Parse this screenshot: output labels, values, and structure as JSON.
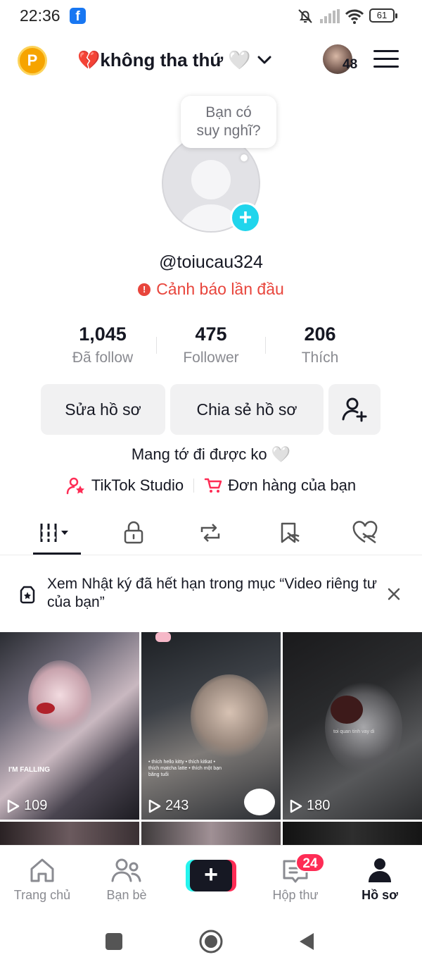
{
  "status_bar": {
    "time": "22:36",
    "app_badge": "f",
    "battery": "61"
  },
  "header": {
    "points_badge": "P",
    "title": "💔không tha thứ 🤍",
    "notification_count": "48"
  },
  "profile": {
    "tooltip_line1": "Bạn có",
    "tooltip_line2": "suy nghĩ?",
    "username": "@toiucau324",
    "warning": "Cảnh báo lần đầu",
    "stats": [
      {
        "value": "1,045",
        "label": "Đã follow"
      },
      {
        "value": "475",
        "label": "Follower"
      },
      {
        "value": "206",
        "label": "Thích"
      }
    ],
    "edit_button": "Sửa hồ sơ",
    "share_button": "Chia sẻ hồ sơ",
    "bio": "Mang tớ đi được ko 🤍",
    "studio_link": "TikTok Studio",
    "orders_link": "Đơn hàng của bạn"
  },
  "banner": {
    "text": "Xem Nhật ký đã hết hạn trong mục “Video riêng tư của bạn”"
  },
  "videos": [
    {
      "views": "109",
      "overlay": "I'M FALLING"
    },
    {
      "views": "243",
      "overlay": "• thích hello kitty • thích kitkat • thích matcha latte • thích một bạn băng tuổi"
    },
    {
      "views": "180",
      "overlay": "toi quan tinh vay di"
    }
  ],
  "bottom_nav": {
    "items": [
      {
        "label": "Trang chủ",
        "icon": "home-icon"
      },
      {
        "label": "Bạn bè",
        "icon": "friends-icon"
      },
      {
        "label": "",
        "icon": "plus-icon"
      },
      {
        "label": "Hộp thư",
        "icon": "inbox-icon"
      },
      {
        "label": "Hồ sơ",
        "icon": "profile-icon"
      }
    ],
    "inbox_badge": "24"
  },
  "colors": {
    "accent_red": "#fe2c55",
    "accent_cyan": "#25f4ee",
    "warning_red": "#e8453c",
    "text_primary": "#161823",
    "text_secondary": "#8a8b91"
  }
}
